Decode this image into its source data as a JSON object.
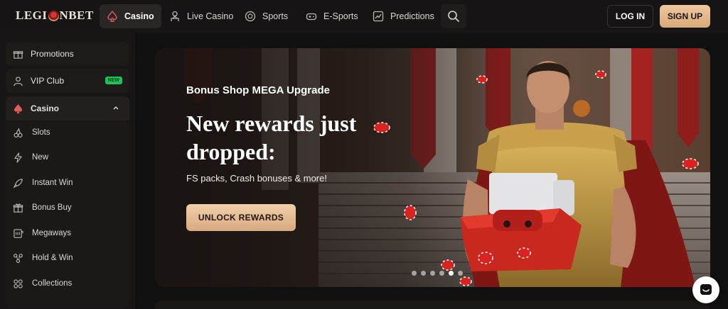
{
  "header": {
    "logo_text_left": "LEGI",
    "logo_text_right": "NBET",
    "nav": [
      {
        "label": "Casino",
        "icon": "spade-icon",
        "active": true
      },
      {
        "label": "Live Casino",
        "icon": "dealer-icon",
        "active": false
      },
      {
        "label": "Sports",
        "icon": "soccer-ball-icon",
        "active": false
      },
      {
        "label": "E-Sports",
        "icon": "gamepad-icon",
        "active": false
      },
      {
        "label": "Predictions",
        "icon": "chart-icon",
        "active": false
      }
    ],
    "login_label": "LOG IN",
    "signup_label": "SIGN UP"
  },
  "sidebar": {
    "items": [
      {
        "label": "Promotions",
        "icon": "gift-icon"
      },
      {
        "label": "VIP Club",
        "icon": "user-icon",
        "badge": "NEW"
      },
      {
        "label": "Casino",
        "icon": "spade-icon",
        "expanded": true
      }
    ],
    "casino_sub": [
      {
        "label": "Slots",
        "icon": "cherries-icon"
      },
      {
        "label": "New",
        "icon": "lightning-icon"
      },
      {
        "label": "Instant Win",
        "icon": "rocket-icon"
      },
      {
        "label": "Bonus Buy",
        "icon": "gift-box-icon"
      },
      {
        "label": "Megaways",
        "icon": "slot-machine-icon"
      },
      {
        "label": "Hold & Win",
        "icon": "hold-win-icon"
      },
      {
        "label": "Collections",
        "icon": "grid-icon"
      }
    ]
  },
  "banner": {
    "subtitle": "Bonus Shop MEGA Upgrade",
    "title": "New rewards just dropped:",
    "description": "FS packs, Crash bonuses & more!",
    "cta": "UNLOCK REWARDS",
    "slides": 6,
    "active_slide": 4
  },
  "colors": {
    "accent": "#e2b389",
    "badge_new": "#1ec25a",
    "background": "#111010"
  }
}
